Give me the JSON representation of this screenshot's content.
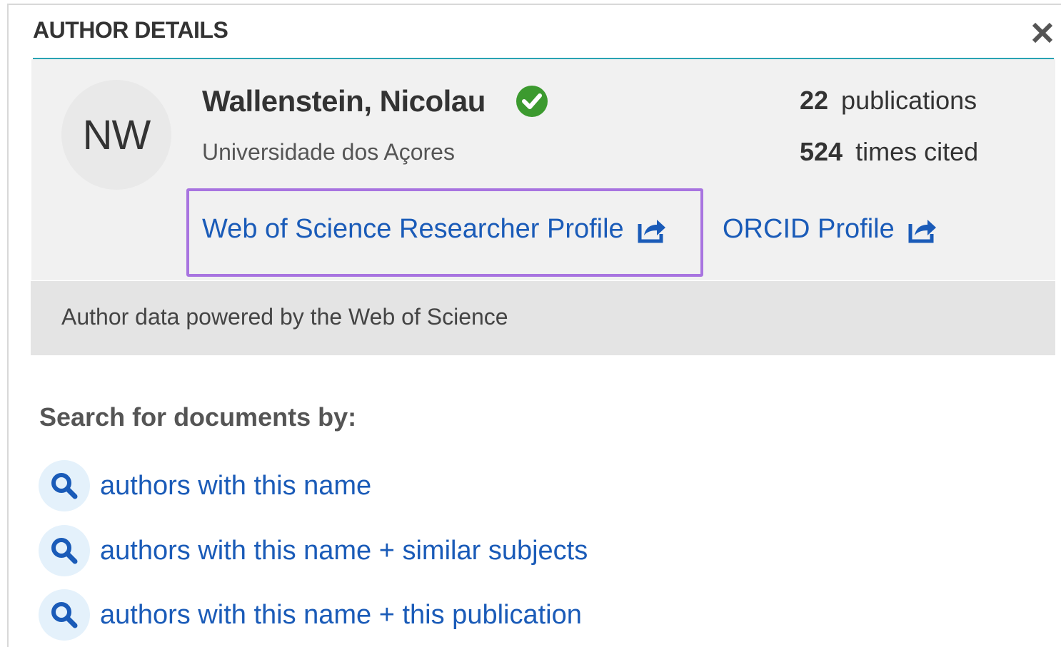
{
  "header": {
    "title": "AUTHOR DETAILS",
    "close_icon": "close-icon"
  },
  "author": {
    "initials": "NW",
    "name": "Wallenstein, Nicolau",
    "verified_icon": "check-circle-icon",
    "verified_color": "#3c9a2f",
    "affiliation": "Universidade dos Açores"
  },
  "stats": {
    "publications_count": "22",
    "publications_label": "publications",
    "cited_count": "524",
    "cited_label": "times cited"
  },
  "links": {
    "wos_label": "Web of Science Researcher Profile",
    "orcid_label": "ORCID Profile",
    "external_icon": "external-link-icon",
    "link_color": "#1a5bb8",
    "highlight_color": "#a874e0"
  },
  "footer": {
    "powered_text": "Author data powered by the Web of Science"
  },
  "search": {
    "heading": "Search for documents by:",
    "icon": "search-icon",
    "items": [
      {
        "label": "authors with this name"
      },
      {
        "label": "authors with this name + similar subjects"
      },
      {
        "label": "authors with this name + this publication"
      }
    ]
  }
}
